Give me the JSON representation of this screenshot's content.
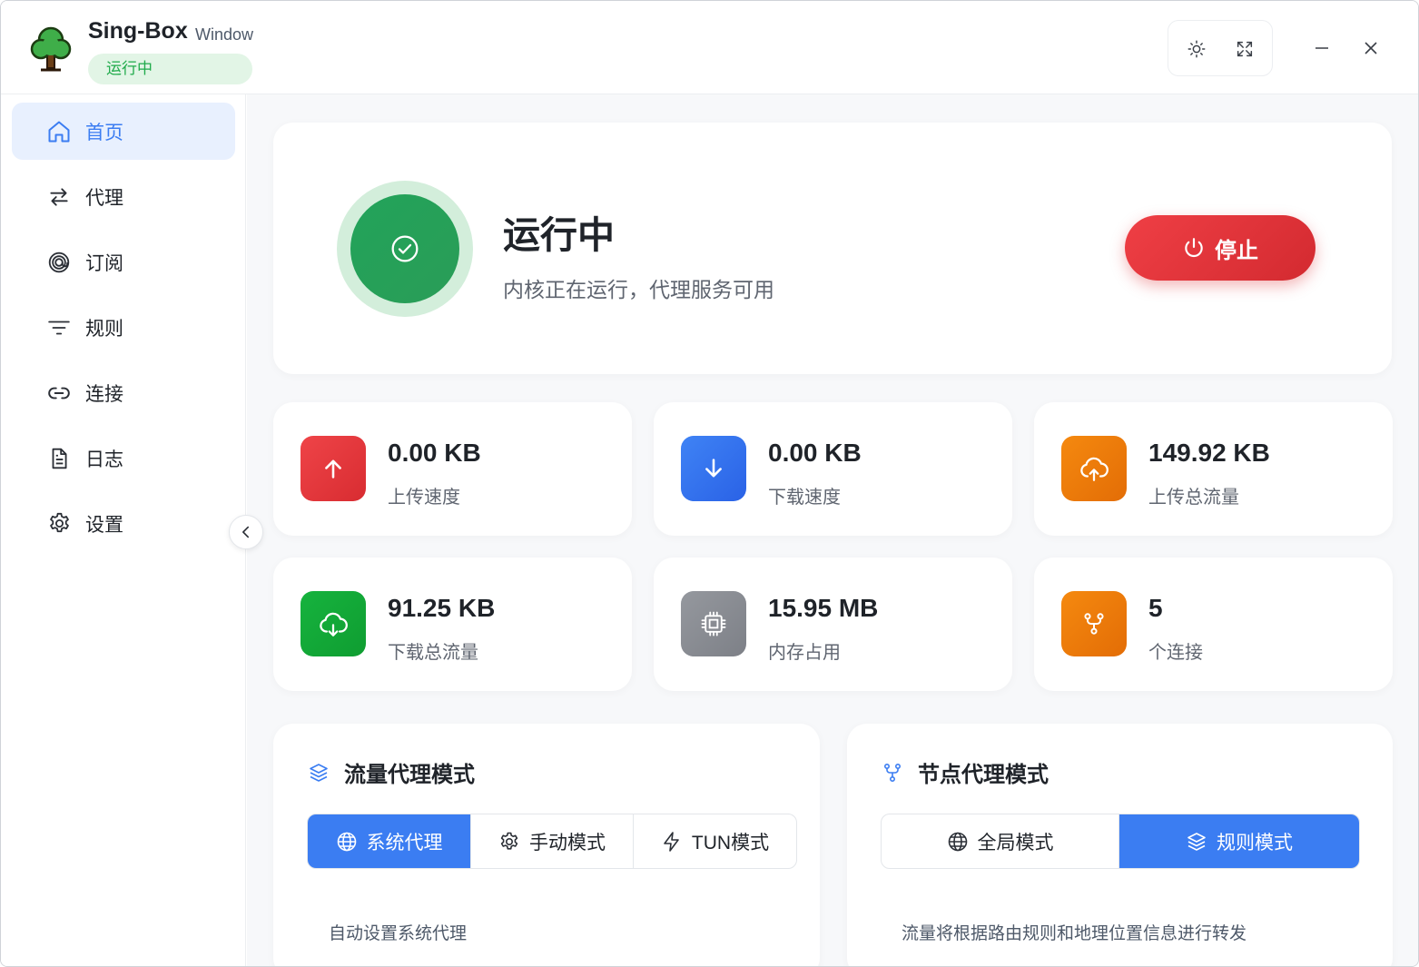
{
  "app": {
    "name": "Sing-Box",
    "sub": "Window",
    "status": "运行中"
  },
  "toolbar": {
    "theme_icon": "sun-icon",
    "fullscreen_icon": "expand-icon",
    "minimize_icon": "minimize-icon",
    "close_icon": "close-icon"
  },
  "sidebar": {
    "items": [
      {
        "label": "首页",
        "icon": "home-icon"
      },
      {
        "label": "代理",
        "icon": "swap-arrows-icon"
      },
      {
        "label": "订阅",
        "icon": "at-icon"
      },
      {
        "label": "规则",
        "icon": "filter-icon"
      },
      {
        "label": "连接",
        "icon": "link-icon"
      },
      {
        "label": "日志",
        "icon": "document-icon"
      },
      {
        "label": "设置",
        "icon": "gear-icon"
      }
    ],
    "active_index": 0
  },
  "hero": {
    "title": "运行中",
    "desc": "内核正在运行，代理服务可用",
    "stop_label": "停止"
  },
  "stats": [
    {
      "value": "0.00 KB",
      "label": "上传速度",
      "color": "#e8383d"
    },
    {
      "value": "0.00 KB",
      "label": "下载速度",
      "color": "#3a72f0"
    },
    {
      "value": "149.92 KB",
      "label": "上传总流量",
      "color": "#f07d0c"
    },
    {
      "value": "91.25 KB",
      "label": "下载总流量",
      "color": "#14a93a"
    },
    {
      "value": "15.95 MB",
      "label": "内存占用",
      "color": "#8a8d93"
    },
    {
      "value": "5",
      "label": "个连接",
      "color": "#f07d0c"
    }
  ],
  "traffic_mode": {
    "title": "流量代理模式",
    "options": [
      "系统代理",
      "手动模式",
      "TUN模式"
    ],
    "selected": 0,
    "desc": "自动设置系统代理"
  },
  "node_mode": {
    "title": "节点代理模式",
    "options": [
      "全局模式",
      "规则模式"
    ],
    "selected": 1,
    "desc": "流量将根据路由规则和地理位置信息进行转发"
  },
  "colors": {
    "accent": "#3b7df2",
    "running": "#22a35a",
    "stop": "#e53a40"
  }
}
